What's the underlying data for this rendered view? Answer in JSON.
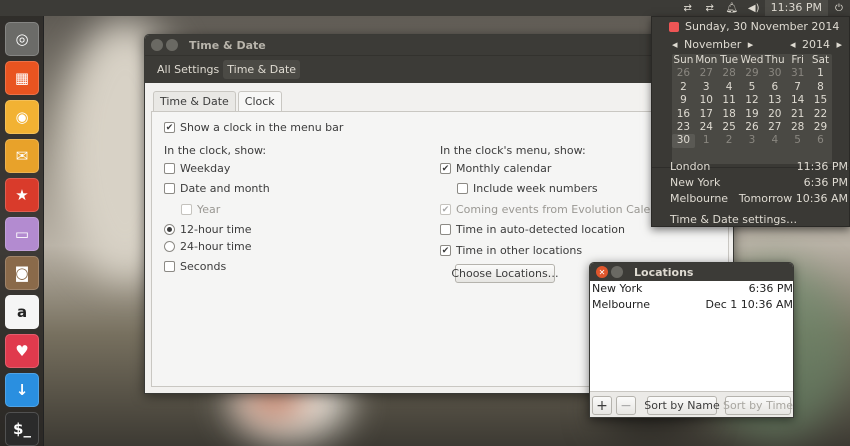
{
  "top_panel": {
    "clock": "11:36 PM",
    "indicators": [
      "network-icon",
      "network-icon",
      "notification-icon",
      "volume-icon"
    ],
    "power_icon": "power-icon"
  },
  "launcher": {
    "items": [
      {
        "name": "ubuntu-icon",
        "glyph": "◎",
        "color": "#6b6b68"
      },
      {
        "name": "apps-icon",
        "glyph": "▦",
        "color": "#e95420"
      },
      {
        "name": "chrome-icon",
        "glyph": "◉",
        "color": "#f2b233"
      },
      {
        "name": "mail-icon",
        "glyph": "✉",
        "color": "#e8a22a"
      },
      {
        "name": "star-icon",
        "glyph": "★",
        "color": "#d93b2b"
      },
      {
        "name": "files-icon",
        "glyph": "▭",
        "color": "#b38bd0"
      },
      {
        "name": "camera-icon",
        "glyph": "◙",
        "color": "#8a6a4a"
      },
      {
        "name": "amazon-icon",
        "glyph": "a",
        "color": "#f5f5f5"
      },
      {
        "name": "pocket-icon",
        "glyph": "♥",
        "color": "#e03a4d"
      },
      {
        "name": "download-icon",
        "glyph": "↓",
        "color": "#2a8fe0"
      },
      {
        "name": "terminal-icon",
        "glyph": "$_",
        "color": "#2b2b2b"
      }
    ]
  },
  "window": {
    "title": "Time & Date",
    "breadcrumbs": [
      "All Settings",
      "Time & Date"
    ],
    "tabs": [
      "Time & Date",
      "Clock"
    ],
    "show_clock": "Show a clock in the menu bar",
    "left_heading": "In the clock, show:",
    "weekday": "Weekday",
    "date_month": "Date and month",
    "year": "Year",
    "h12": "12-hour time",
    "h24": "24-hour time",
    "seconds": "Seconds",
    "right_heading": "In the clock's menu, show:",
    "monthly_calendar": "Monthly calendar",
    "week_numbers": "Include week numbers",
    "coming_events": "Coming events from Evolution Calendar",
    "auto_location": "Time in auto-detected location",
    "other_locations": "Time in other locations",
    "choose_locations": "Choose Locations…"
  },
  "calendar": {
    "full_date": "Sunday, 30 November 2014",
    "month": "November",
    "year": "2014",
    "prev_arrow": "◂",
    "next_arrow": "▸",
    "weekdays": [
      "Sun",
      "Mon",
      "Tue",
      "Wed",
      "Thu",
      "Fri",
      "Sat"
    ],
    "weeks": [
      [
        "26",
        "27",
        "28",
        "29",
        "30",
        "31",
        "1"
      ],
      [
        "2",
        "3",
        "4",
        "5",
        "6",
        "7",
        "8"
      ],
      [
        "9",
        "10",
        "11",
        "12",
        "13",
        "14",
        "15"
      ],
      [
        "16",
        "17",
        "18",
        "19",
        "20",
        "21",
        "22"
      ],
      [
        "23",
        "24",
        "25",
        "26",
        "27",
        "28",
        "29"
      ],
      [
        "30",
        "1",
        "2",
        "3",
        "4",
        "5",
        "6"
      ]
    ],
    "cities": [
      {
        "name": "London",
        "time": "11:36 PM"
      },
      {
        "name": "New York",
        "time": "6:36 PM"
      },
      {
        "name": "Melbourne",
        "time": "Tomorrow 10:36 AM"
      }
    ],
    "settings": "Time & Date settings…"
  },
  "locations": {
    "title": "Locations",
    "items": [
      {
        "name": "New York",
        "time": "6:36 PM"
      },
      {
        "name": "Melbourne",
        "time": "Dec 1 10:36 AM"
      }
    ],
    "add": "+",
    "remove": "−",
    "sort_name": "Sort by Name",
    "sort_time": "Sort by Time"
  }
}
